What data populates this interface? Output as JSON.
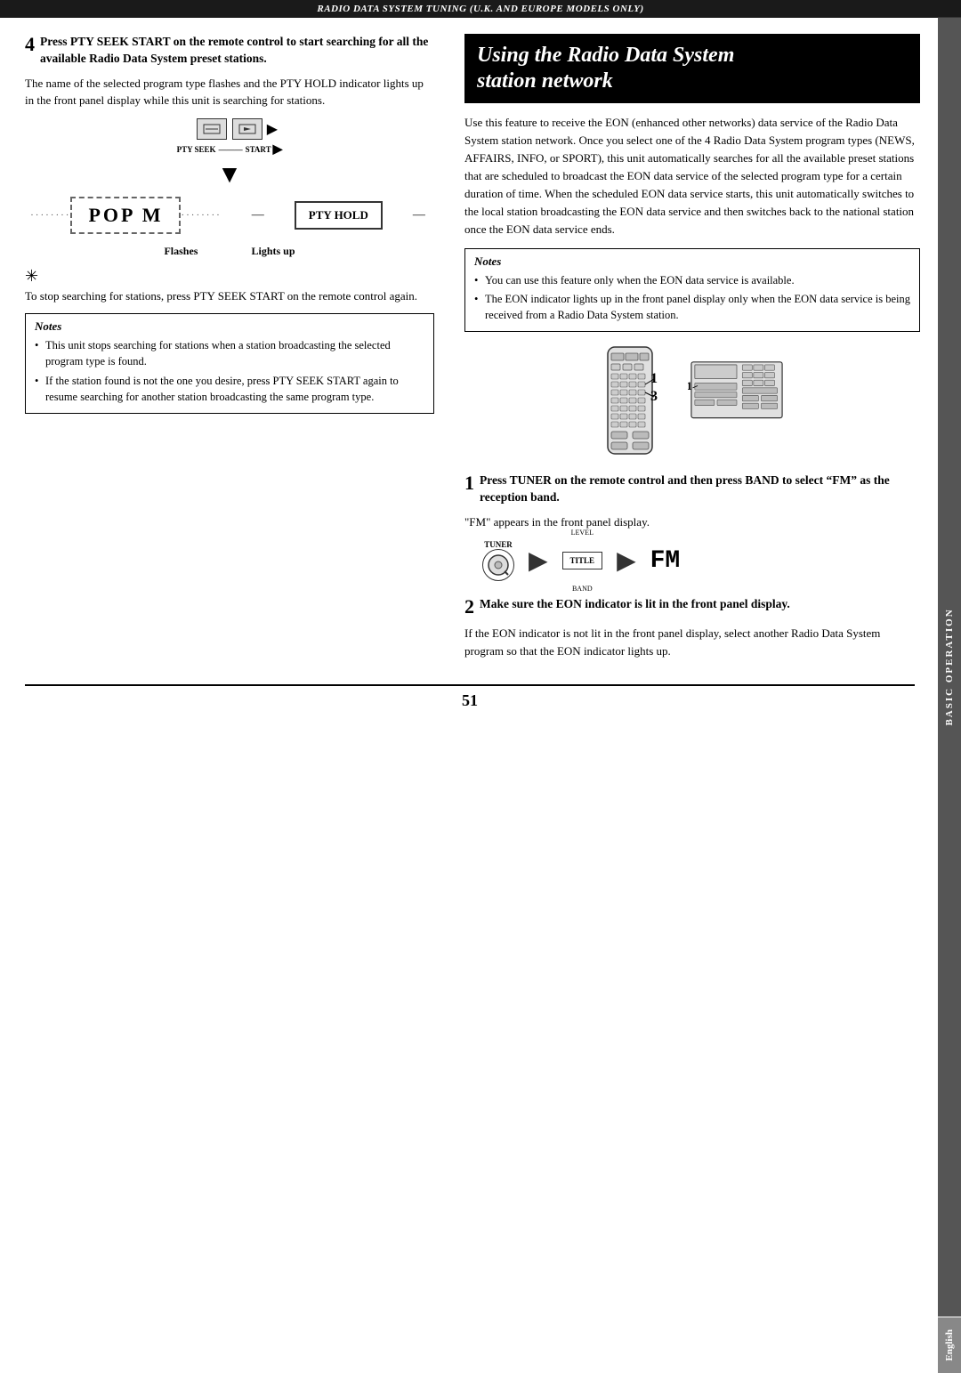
{
  "header": {
    "text": "RADIO DATA SYSTEM TUNING (U.K. AND EUROPE MODELS ONLY)"
  },
  "left_column": {
    "step4": {
      "number": "4",
      "heading": "Press PTY SEEK START on the remote control to start searching for all the available Radio Data System preset stations.",
      "body": "The name of the selected program type flashes and the PTY HOLD indicator lights up in the front panel display while this unit is searching for stations.",
      "pty_seek_label": "PTY SEEK",
      "start_label": "START",
      "flashes_label": "Flashes",
      "lights_up_label": "Lights up",
      "pop_m_text": "POP M",
      "pty_hold_text": "PTY HOLD",
      "stop_note": "To stop searching for stations, press PTY SEEK START on the remote control again.",
      "notes": {
        "title": "Notes",
        "items": [
          "This unit stops searching for stations when a station broadcasting the selected program type is found.",
          "If the station found is not the one you desire, press PTY SEEK START again to resume searching for another station broadcasting the same program type."
        ]
      }
    }
  },
  "right_column": {
    "section_title_line1": "Using the Radio Data System",
    "section_title_line2": "station network",
    "intro_text": "Use this feature to receive the EON (enhanced other networks) data service of the Radio Data System station network. Once you select one of the 4 Radio Data System program types (NEWS, AFFAIRS, INFO, or SPORT), this unit automatically searches for all the available preset stations that are scheduled to broadcast the EON data service of the selected program type for a certain duration of time. When the scheduled EON data service starts, this unit automatically switches to the local station broadcasting the EON data service and then switches back to the national station once the EON data service ends.",
    "notes": {
      "title": "Notes",
      "items": [
        "You can use this feature only when the EON data service is available.",
        "The EON indicator lights up in the front panel display only when the EON data service is being received from a Radio Data System station."
      ]
    },
    "step1": {
      "number": "1",
      "heading": "Press TUNER on the remote control and then press BAND to select “FM” as the reception band.",
      "body": "\"FM\" appears in the front panel display.",
      "tuner_label": "TUNER",
      "level_label": "LEVEL",
      "title_label": "TITLE",
      "band_label": "BAND",
      "fm_text": "FM"
    },
    "step2": {
      "number": "2",
      "heading": "Make sure the EON indicator is lit in the front panel display.",
      "body": "If the EON indicator is not lit in the front panel display, select another Radio Data System program so that the EON indicator lights up."
    }
  },
  "sidebar": {
    "basic_operation": "BASIC OPERATION",
    "english": "English"
  },
  "page_number": "51"
}
